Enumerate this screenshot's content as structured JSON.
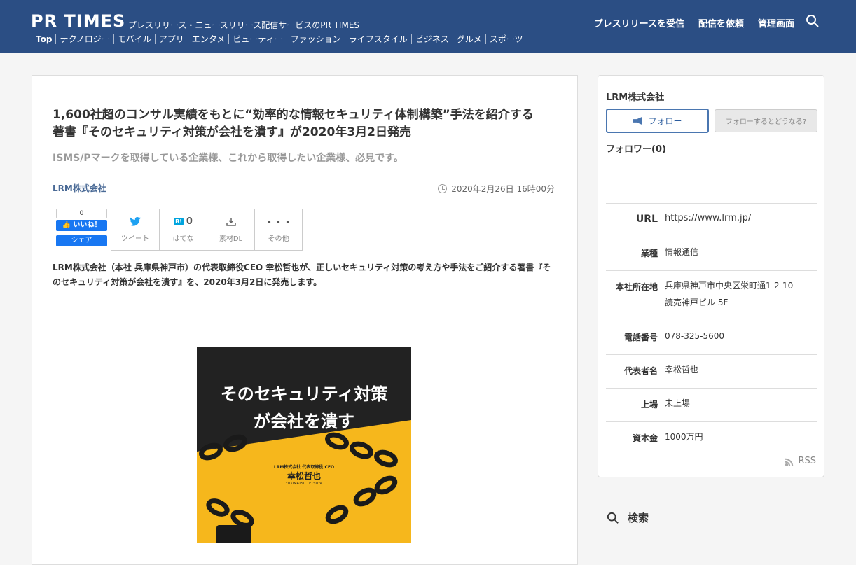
{
  "header": {
    "logo": "PR TIMES",
    "tagline": "プレスリリース・ニュースリリース配信サービスのPR TIMES",
    "nav": [
      "プレスリリースを受信",
      "配信を依頼",
      "管理画面"
    ],
    "categories": [
      "Top",
      "テクノロジー",
      "モバイル",
      "アプリ",
      "エンタメ",
      "ビューティー",
      "ファッション",
      "ライフスタイル",
      "ビジネス",
      "グルメ",
      "スポーツ"
    ]
  },
  "article": {
    "title": "1,600社超のコンサル実績をもとに“効率的な情報セキュリティ体制構築”手法を紹介する著書『そのセキュリティ対策が会社を潰す』が2020年3月2日発売",
    "subtitle": "ISMS/Pマークを取得している企業様、これから取得したい企業様、必見です。",
    "company": "LRM株式会社",
    "date": "2020年2月26日 16時00分",
    "share": {
      "fb_count": "0",
      "fb_like": "いいね！",
      "fb_share": "シェア",
      "tweet": "ツイート",
      "hatena_count": "0",
      "hatena": "はてな",
      "download": "素材DL",
      "more_glyph": "・・・",
      "more": "その他"
    },
    "lead": "LRM株式会社（本社 兵庫県神戸市）の代表取締役CEO 幸松哲也が、正しいセキュリティ対策の考え方や手法をご紹介する著書『そのセキュリティ対策が会社を潰す』を、2020年3月2日に発売します。",
    "book": {
      "title_line1": "そのセキュリティ対策",
      "title_line2": "が会社を潰す",
      "role": "LRM株式会社 代表取締役 CEO",
      "author": "幸松哲也",
      "author_roman": "YUKIMATSU TETSUYA"
    }
  },
  "sidebar": {
    "company": "LRM株式会社",
    "follow": "フォロー",
    "follow_what": "フォローするとどうなる?",
    "followers": "フォロワー(0)",
    "info": [
      {
        "label": "URL",
        "value": "https://www.lrm.jp/"
      },
      {
        "label": "業種",
        "value": "情報通信"
      },
      {
        "label": "本社所在地",
        "value": "兵庫県神戸市中央区栄町通1-2-10\n読売神戸ビル 5F"
      },
      {
        "label": "電話番号",
        "value": "078-325-5600"
      },
      {
        "label": "代表者名",
        "value": "幸松哲也"
      },
      {
        "label": "上場",
        "value": "未上場"
      },
      {
        "label": "資本金",
        "value": "1000万円"
      }
    ],
    "rss": "RSS",
    "search": "検索"
  },
  "colors": {
    "header_bg": "#2b4e84",
    "link": "#4a6a96",
    "book_yellow": "#f6b71c"
  }
}
